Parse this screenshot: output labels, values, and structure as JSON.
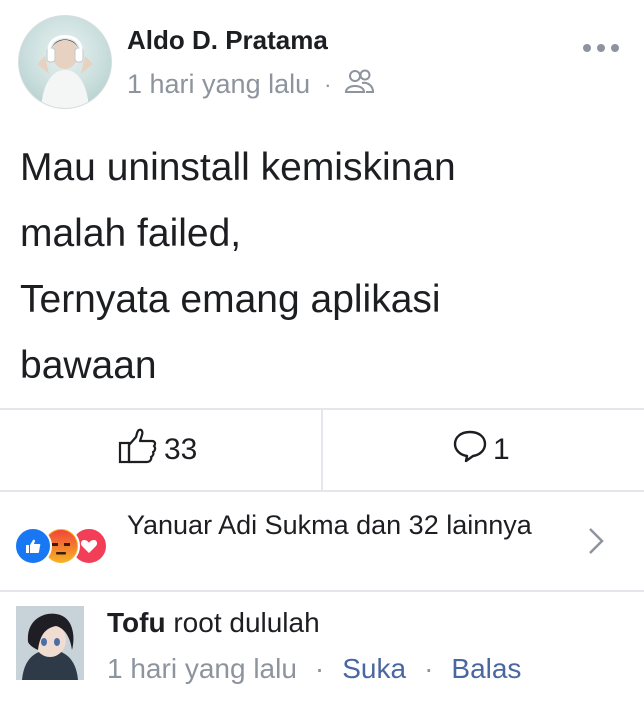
{
  "post": {
    "author": "Aldo D. Pratama",
    "time": "1 hari yang lalu",
    "separator": "·",
    "audience_icon": "friends-icon",
    "lines": [
      "Mau uninstall kemiskinan",
      "malah failed,",
      "Ternyata emang aplikasi",
      "bawaan"
    ]
  },
  "actions": {
    "like_count": "33",
    "comment_count": "1"
  },
  "reactions": {
    "icons": [
      "like-icon",
      "angry-icon",
      "love-icon"
    ],
    "text": "Yanuar Adi Sukma dan 32 lainnya"
  },
  "comment": {
    "author": "Tofu",
    "text": "root dululah",
    "time": "1 hari yang lalu",
    "separator": "·",
    "like_label": "Suka",
    "reply_label": "Balas"
  },
  "colors": {
    "meta": "#8d949e",
    "link": "#4b67a1",
    "like": "#1877f2",
    "angry": "#f25268",
    "love": "#f33e58"
  }
}
